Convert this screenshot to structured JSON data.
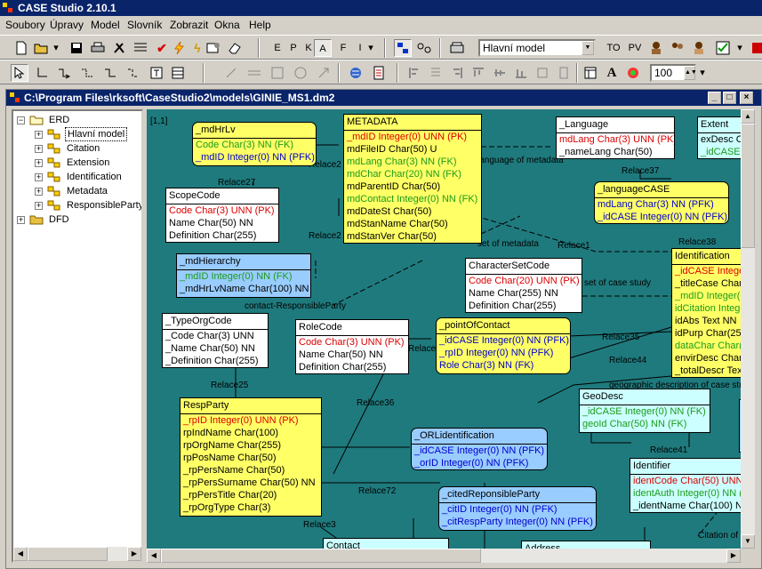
{
  "app": {
    "title": "CASE Studio 2.10.1"
  },
  "menu": [
    "Soubory",
    "Úpravy",
    "Model",
    "Slovník",
    "Zobrazit",
    "Okna",
    "Help"
  ],
  "toolbar1": {
    "letters": [
      "E",
      "P",
      "K",
      "A",
      "F",
      "I"
    ],
    "model_select": "Hlavní model",
    "to_label": "TO",
    "pv_label": "PV"
  },
  "toolbar2": {
    "zoom": "100"
  },
  "document": {
    "title": "C:\\Program Files\\rksoft\\CaseStudio2\\models\\GINIE_MS1.dm2"
  },
  "tree": {
    "root1": "ERD",
    "items": [
      "Hlavní model",
      "Citation",
      "Extension",
      "Identification",
      "Metadata",
      "ResponsibleParty"
    ],
    "root2": "DFD"
  },
  "diagram": {
    "coords": "[1,1]",
    "relations": {
      "relace2a": "Relace2",
      "relace27": "Relace27",
      "relace2b": "Relace2",
      "language_of_metadata": "language of metadata",
      "relace37": "Relace37",
      "relace1": "Relace1",
      "relace38": "Relace38",
      "charset_metadata": "set of metadata",
      "charset_case": "set of case study",
      "contact_rp": "contact-ResponsibleParty",
      "relace35": "Relace35",
      "relace44": "Relace44",
      "relace_t": "Relace",
      "relace25": "Relace25",
      "relace36": "Relace36",
      "geo_desc": "geographic description of case stu",
      "relace41": "Relace41",
      "relace72": "Relace72",
      "relace3": "Relace3",
      "citation_of": "Citation of"
    },
    "entities": {
      "mdHrLv": {
        "title": "_mdHrLv",
        "rows": [
          "Code Char(3) NN (FK)",
          "_mdID Integer(0) NN (PFK)"
        ]
      },
      "metadata": {
        "title": "METADATA",
        "rows": [
          "_mdID Integer(0) UNN (PK)",
          "mdFileID Char(50) U",
          "mdLang Char(3) NN (FK)",
          "mdChar Char(20) NN (FK)",
          "mdParentID Char(50)",
          "mdContact Integer(0) NN (FK)",
          "mdDateSt Char(50)",
          "mdStanName Char(50)",
          "mdStanVer Char(50)"
        ]
      },
      "language": {
        "title": "_Language",
        "rows": [
          "mdLang Char(3) UNN (PK)",
          "_nameLang Char(50)"
        ]
      },
      "extent": {
        "title": "Extent",
        "rows": [
          "exDesc Char(",
          "_idCASE Inte"
        ]
      },
      "scopeCode": {
        "title": "ScopeCode",
        "rows": [
          "Code Char(3) UNN (PK)",
          "Name Char(50) NN",
          "Definition Char(255)"
        ]
      },
      "languageCase": {
        "title": "_languageCASE",
        "rows": [
          "mdLang Char(3) NN (PFK)",
          "_idCASE Integer(0) NN (PFK)"
        ]
      },
      "mdHierarchy": {
        "title": "_mdHierarchy",
        "rows": [
          "_mdID Integer(0) NN (FK)",
          "_mdHrLvName Char(100) NN"
        ]
      },
      "characterSetCode": {
        "title": "CharacterSetCode",
        "rows": [
          "Code Char(20) UNN (PK)",
          "Name Char(255) NN",
          "Definition Char(255)"
        ]
      },
      "identification": {
        "title": "Identification",
        "rows": [
          "_idCASE Integer",
          "_titleCase Char(2",
          "_mdID Integer(0)",
          "idCitation Integer",
          "idAbs Text NN",
          "idPurp Char(255)",
          "dataChar Char(2",
          "envirDesc Char(",
          "_totalDescr Text"
        ]
      },
      "typeOrgCode": {
        "title": "_TypeOrgCode",
        "rows": [
          "_Code Char(3) UNN",
          "_Name Char(50) NN",
          "_Definition Char(255)"
        ]
      },
      "roleCode": {
        "title": "RoleCode",
        "rows": [
          "Code Char(3) UNN (PK)",
          "Name Char(50) NN",
          "Definition Char(255)"
        ]
      },
      "pointOfContact": {
        "title": "_pointOfContact",
        "rows": [
          "_idCASE Integer(0) NN (PFK)",
          "_rpID Integer(0) NN (PFK)",
          "Role Char(3) NN (FK)"
        ]
      },
      "geoDesc": {
        "title": "GeoDesc",
        "rows": [
          "_idCASE Integer(0) NN (FK)",
          "geoId Char(50) NN (FK)"
        ]
      },
      "respParty": {
        "title": "RespParty",
        "rows": [
          "_rpID Integer(0) UNN (PK)",
          "rpIndName Char(100)",
          "rpOrgName Char(255)",
          "rpPosName Char(50)",
          "_rpPersName Char(50)",
          "_rpPersSurname Char(50) NN",
          "_rpPersTitle Char(20)",
          "_rpOrgType Char(3)"
        ]
      },
      "orlIdentification": {
        "title": "_ORLidentification",
        "rows": [
          "_idCASE Integer(0) NN (PFK)",
          "_orID Integer(0) NN (PFK)"
        ]
      },
      "identifier": {
        "title": "Identifier",
        "rows": [
          "identCode Char(50) UNN (",
          "identAuth Integer(0) NN (F",
          "_identName Char(100) NN"
        ]
      },
      "citedResp": {
        "title": "_citedReponsibleParty",
        "rows": [
          "_citID Integer(0) NN (PFK)",
          "_citRespParty Integer(0) NN (PFK)"
        ]
      },
      "contact": {
        "title": "Contact"
      },
      "address": {
        "title": "Address"
      }
    }
  },
  "colors": {
    "titlebar": "#0a246a",
    "canvas": "#1f7a7d",
    "yellow": "#ffff66",
    "blue": "#99ccff",
    "cyan": "#ccffff",
    "pk_red": "#dd0000",
    "fk_green": "#1a9c1a",
    "fk_blue": "#0000cc"
  }
}
